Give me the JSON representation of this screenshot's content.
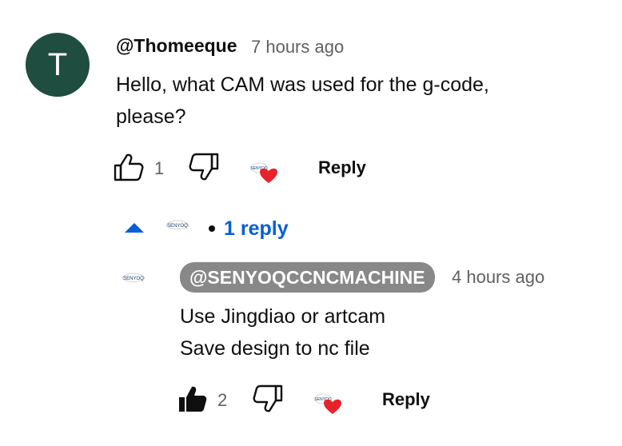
{
  "comment": {
    "avatar_letter": "T",
    "author": "@Thomeeque",
    "time": "7 hours ago",
    "text_line1": "Hello, what CAM was used for the g-code,",
    "text_line2": "please?",
    "likes": "1",
    "reply_label": "Reply"
  },
  "replies_toggle": {
    "label": "1 reply",
    "separator": "•"
  },
  "reply": {
    "author": "@SENYOQCCNCMACHINE",
    "time": "4 hours ago",
    "text_line1": "Use Jingdiao or artcam",
    "text_line2": "Save design to nc file",
    "likes": "2",
    "reply_label": "Reply"
  },
  "colors": {
    "avatar_bg": "#1f4d3f",
    "link_blue": "#065fd4",
    "heart_red": "#e8222a",
    "badge_gray": "#888888"
  },
  "icons": {
    "like": "thumbs-up-icon",
    "dislike": "thumbs-down-icon",
    "creator_heart": "creator-heart-icon",
    "collapse": "caret-up-icon"
  }
}
